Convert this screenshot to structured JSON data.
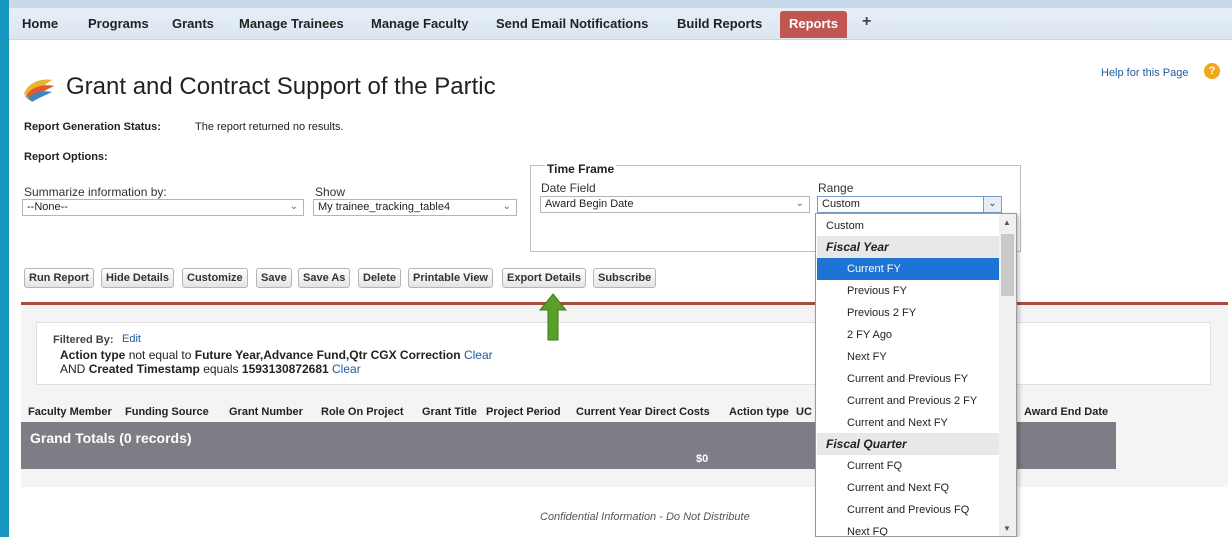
{
  "nav": {
    "tabs": [
      "Home",
      "Programs",
      "Grants",
      "Manage Trainees",
      "Manage Faculty",
      "Send Email Notifications",
      "Build Reports",
      "Reports"
    ],
    "active_tab": "Reports",
    "add_tab": "+"
  },
  "header": {
    "title": "Grant and Contract Support of the Partic",
    "help_link": "Help for this Page",
    "help_icon": "?"
  },
  "status": {
    "label": "Report Generation Status:",
    "text": "The report returned no results."
  },
  "options": {
    "label": "Report Options:",
    "summarize_label": "Summarize information by:",
    "summarize_value": "--None--",
    "show_label": "Show",
    "show_value": "My trainee_tracking_table4",
    "timeframe_legend": "Time Frame",
    "date_field_label": "Date Field",
    "date_field_value": "Award Begin Date",
    "range_label": "Range",
    "range_value": "Custom"
  },
  "buttons": [
    "Run Report",
    "Hide Details",
    "Customize",
    "Save",
    "Save As",
    "Delete",
    "Printable View",
    "Export Details",
    "Subscribe"
  ],
  "filters": {
    "label": "Filtered By:",
    "edit": "Edit",
    "line1": {
      "field": "Action type",
      "op": "not equal to",
      "value": "Future Year,Advance Fund,Qtr CGX Correction",
      "clear": "Clear"
    },
    "line2": {
      "prefix": "AND",
      "field": "Created Timestamp",
      "op": "equals",
      "value": "1593130872681",
      "clear": "Clear"
    }
  },
  "table": {
    "columns": [
      "Faculty Member",
      "Funding Source",
      "Grant Number",
      "Role On Project",
      "Grant Title",
      "Project Period",
      "Current Year Direct Costs",
      "Action type",
      "UC",
      "Award End Date"
    ],
    "grand_totals_label": "Grand Totals (0 records)",
    "grand_totals_value": "$0"
  },
  "footer": {
    "confidential": "Confidential Information - Do Not Distribute"
  },
  "range_dropdown": {
    "items": [
      {
        "label": "Custom",
        "kind": "option-top"
      },
      {
        "label": "Fiscal Year",
        "kind": "group"
      },
      {
        "label": "Current FY",
        "kind": "option",
        "selected": true
      },
      {
        "label": "Previous FY",
        "kind": "option"
      },
      {
        "label": "Previous 2 FY",
        "kind": "option"
      },
      {
        "label": "2 FY Ago",
        "kind": "option"
      },
      {
        "label": "Next FY",
        "kind": "option"
      },
      {
        "label": "Current and Previous FY",
        "kind": "option"
      },
      {
        "label": "Current and Previous 2 FY",
        "kind": "option"
      },
      {
        "label": "Current and Next FY",
        "kind": "option"
      },
      {
        "label": "Fiscal Quarter",
        "kind": "group"
      },
      {
        "label": "Current FQ",
        "kind": "option"
      },
      {
        "label": "Current and Next FQ",
        "kind": "option"
      },
      {
        "label": "Current and Previous FQ",
        "kind": "option"
      },
      {
        "label": "Next FQ",
        "kind": "option"
      }
    ]
  },
  "colors": {
    "active_tab": "#c05552",
    "selected_item": "#1d74d4",
    "grand_totals_bg": "#7d7d86",
    "annotation_arrow": "#5aa028",
    "link": "#1f5aa6"
  }
}
